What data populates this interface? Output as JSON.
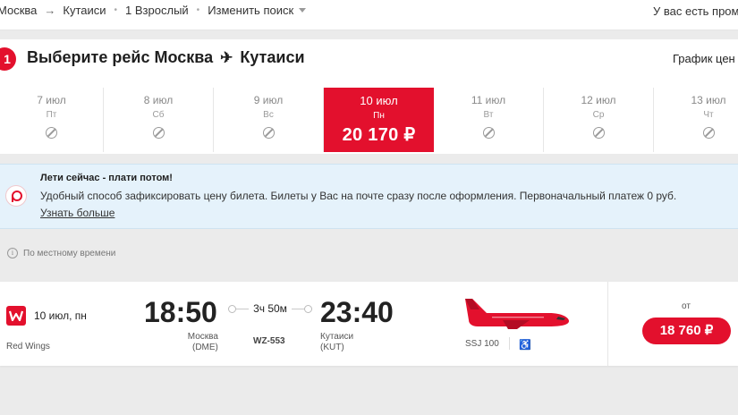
{
  "topbar": {
    "origin": "Москва",
    "arrow": "→",
    "destination": "Кутаиси",
    "passengers": "1 Взрослый",
    "change_search": "Изменить поиск",
    "promo_text": "У вас есть промо"
  },
  "selection": {
    "step": "1",
    "title_prefix": "Выберите рейс Москва",
    "title_dest": "Кутаиси",
    "plane_glyph": "✈",
    "price_chart": "График цен"
  },
  "dates": [
    {
      "date": "7 июл",
      "weekday": "Пт"
    },
    {
      "date": "8 июл",
      "weekday": "Сб"
    },
    {
      "date": "9 июл",
      "weekday": "Вс"
    },
    {
      "date": "10 июл",
      "weekday": "Пн",
      "price": "20 170 ₽"
    },
    {
      "date": "11 июл",
      "weekday": "Вт"
    },
    {
      "date": "12 июл",
      "weekday": "Ср"
    },
    {
      "date": "13 июл",
      "weekday": "Чт"
    }
  ],
  "promo": {
    "title": "Лети сейчас - плати потом!",
    "text": "Удобный способ зафиксировать цену билета. Билеты у Вас на почте сразу после оформления. Первоначальный платеж 0 руб.",
    "link": "Узнать больше"
  },
  "localtime_note": "По местному времени",
  "flight": {
    "date": "10 июл, пн",
    "airline": "Red Wings",
    "dep_time": "18:50",
    "arr_time": "23:40",
    "duration": "3ч 50м",
    "flight_no": "WZ-553",
    "dep_city": "Москва",
    "dep_code": "(DME)",
    "arr_city": "Кутаиси",
    "arr_code": "(KUT)",
    "aircraft": "SSJ 100",
    "from_label": "от",
    "price": "18 760 ₽"
  },
  "colors": {
    "accent": "#e3102d",
    "banner_bg": "#e5f2fb",
    "page_bg": "#ebebeb"
  }
}
